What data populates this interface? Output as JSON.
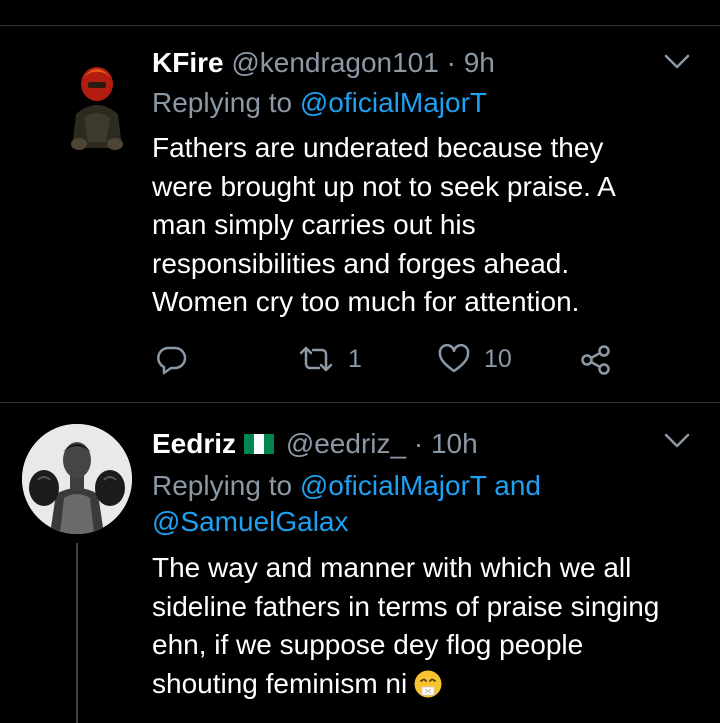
{
  "tweets": [
    {
      "name": "KFire",
      "handle": "@kendragon101",
      "dot": "·",
      "time": "9h",
      "reply_prefix": "Replying to",
      "reply_to": "@oficialMajorT",
      "body_lines": [
        "Fathers are underated because they",
        "were brought up not to seek praise. A",
        "man simply carries out his",
        "responsibilities and forges ahead.",
        "Women cry too much for attention."
      ],
      "retweets": "1",
      "likes": "10"
    },
    {
      "name": "Eedriz",
      "handle": "@eedriz_",
      "dot": "·",
      "time": "10h",
      "reply_prefix": "Replying to",
      "reply_to": "@oficialMajorT",
      "reply_and": "and",
      "reply_to_2": "@SamuelGalax",
      "body_lines": [
        "The way and manner with which we all",
        "sideline fathers in terms of praise singing",
        "ehn, if we suppose dey flog people",
        "shouting feminism ni"
      ]
    }
  ],
  "colors": {
    "background": "#000000",
    "secondary_text": "#8b98a5",
    "link": "#1da1f2",
    "divider": "#2f3336",
    "flag_green": "#008751"
  },
  "icons": [
    "chevron-down-icon",
    "reply-icon",
    "retweet-icon",
    "like-icon",
    "share-icon",
    "nigeria-flag-icon",
    "sneezing-face-emoji"
  ]
}
